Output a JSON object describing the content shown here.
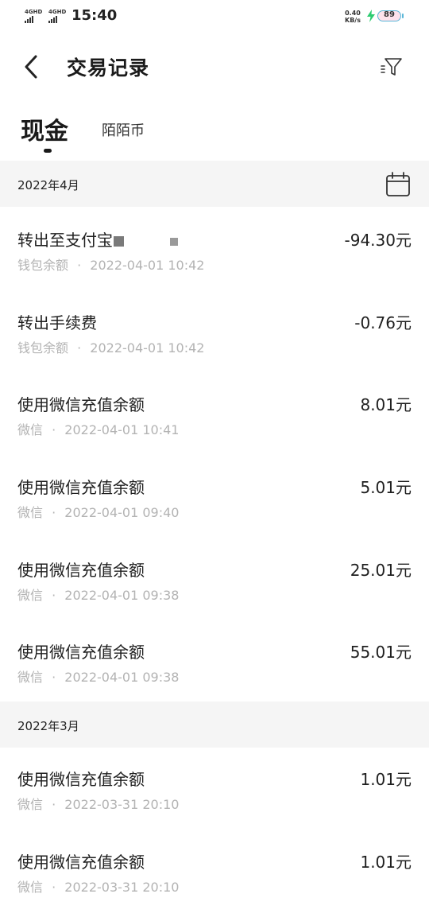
{
  "status_bar": {
    "sim1": "4GHD",
    "sim2": "4GHD",
    "time": "15:40",
    "net_speed_value": "0.40",
    "net_speed_unit": "KB/s",
    "battery": "89"
  },
  "header": {
    "title": "交易记录"
  },
  "tabs": [
    {
      "label": "现金",
      "active": true
    },
    {
      "label": "陌陌币",
      "active": false
    }
  ],
  "months": [
    {
      "label": "2022年4月"
    },
    {
      "label": "2022年3月"
    }
  ],
  "transactions": [
    {
      "title": "转出至支付宝",
      "source": "钱包余额",
      "sep": "·",
      "datetime": "2022-04-01 10:42",
      "amount": "-94.30元"
    },
    {
      "title": "转出手续费",
      "source": "钱包余额",
      "sep": "·",
      "datetime": "2022-04-01 10:42",
      "amount": "-0.76元"
    },
    {
      "title": "使用微信充值余额",
      "source": "微信",
      "sep": "·",
      "datetime": "2022-04-01 10:41",
      "amount": "8.01元"
    },
    {
      "title": "使用微信充值余额",
      "source": "微信",
      "sep": "·",
      "datetime": "2022-04-01 09:40",
      "amount": "5.01元"
    },
    {
      "title": "使用微信充值余额",
      "source": "微信",
      "sep": "·",
      "datetime": "2022-04-01 09:38",
      "amount": "25.01元"
    },
    {
      "title": "使用微信充值余额",
      "source": "微信",
      "sep": "·",
      "datetime": "2022-04-01 09:38",
      "amount": "55.01元"
    },
    {
      "title": "使用微信充值余额",
      "source": "微信",
      "sep": "·",
      "datetime": "2022-03-31 20:10",
      "amount": "1.01元"
    },
    {
      "title": "使用微信充值余额",
      "source": "微信",
      "sep": "·",
      "datetime": "2022-03-31 20:10",
      "amount": "1.01元"
    }
  ],
  "icons": {
    "back": "chevron-left-icon",
    "filter": "filter-icon",
    "calendar": "calendar-icon",
    "charging": "bolt-icon"
  },
  "colors": {
    "text_primary": "#1f1f1f",
    "text_secondary": "#b3b3b3",
    "section_bg": "#f5f5f5",
    "charging": "#2ecc71",
    "battery_border": "#5ab7d8"
  }
}
